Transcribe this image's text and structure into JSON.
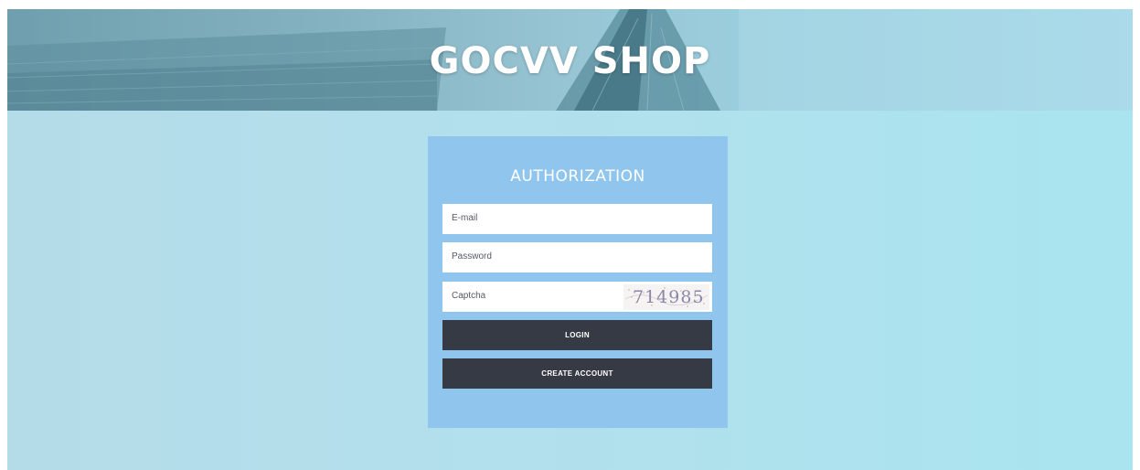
{
  "header": {
    "title": "GOCVV SHOP"
  },
  "login": {
    "title": "AUTHORIZATION",
    "email_placeholder": "E-mail",
    "password_placeholder": "Password",
    "captcha_placeholder": "Captcha",
    "captcha_code": "714985",
    "login_label": "LOGIN",
    "create_account_label": "CREATE ACCOUNT"
  },
  "colors": {
    "panel": "#90c5ee",
    "button": "#363a45",
    "background": "#b2e0ec"
  }
}
